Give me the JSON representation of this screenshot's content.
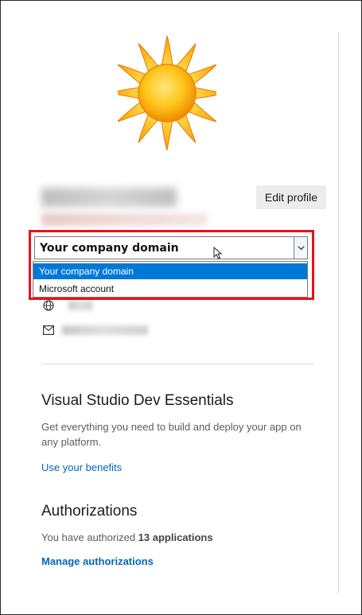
{
  "profile": {
    "edit_label": "Edit profile"
  },
  "account_select": {
    "selected": "Your company domain",
    "options": [
      "Your company domain",
      "Microsoft account"
    ]
  },
  "dev_essentials": {
    "heading": "Visual Studio Dev Essentials",
    "description": "Get everything you need to build and deploy your app on any platform.",
    "link": "Use your benefits"
  },
  "authorizations": {
    "heading": "Authorizations",
    "text_prefix": "You have authorized ",
    "count_text": "13 applications",
    "link": "Manage authorizations"
  },
  "icons": {
    "avatar": "sun-avatar",
    "globe": "globe-icon",
    "mail": "mail-icon",
    "dropdown": "chevron-down-icon"
  },
  "colors": {
    "accent": "#0067b8",
    "selection": "#0078d7",
    "highlight": "#e4141b"
  }
}
